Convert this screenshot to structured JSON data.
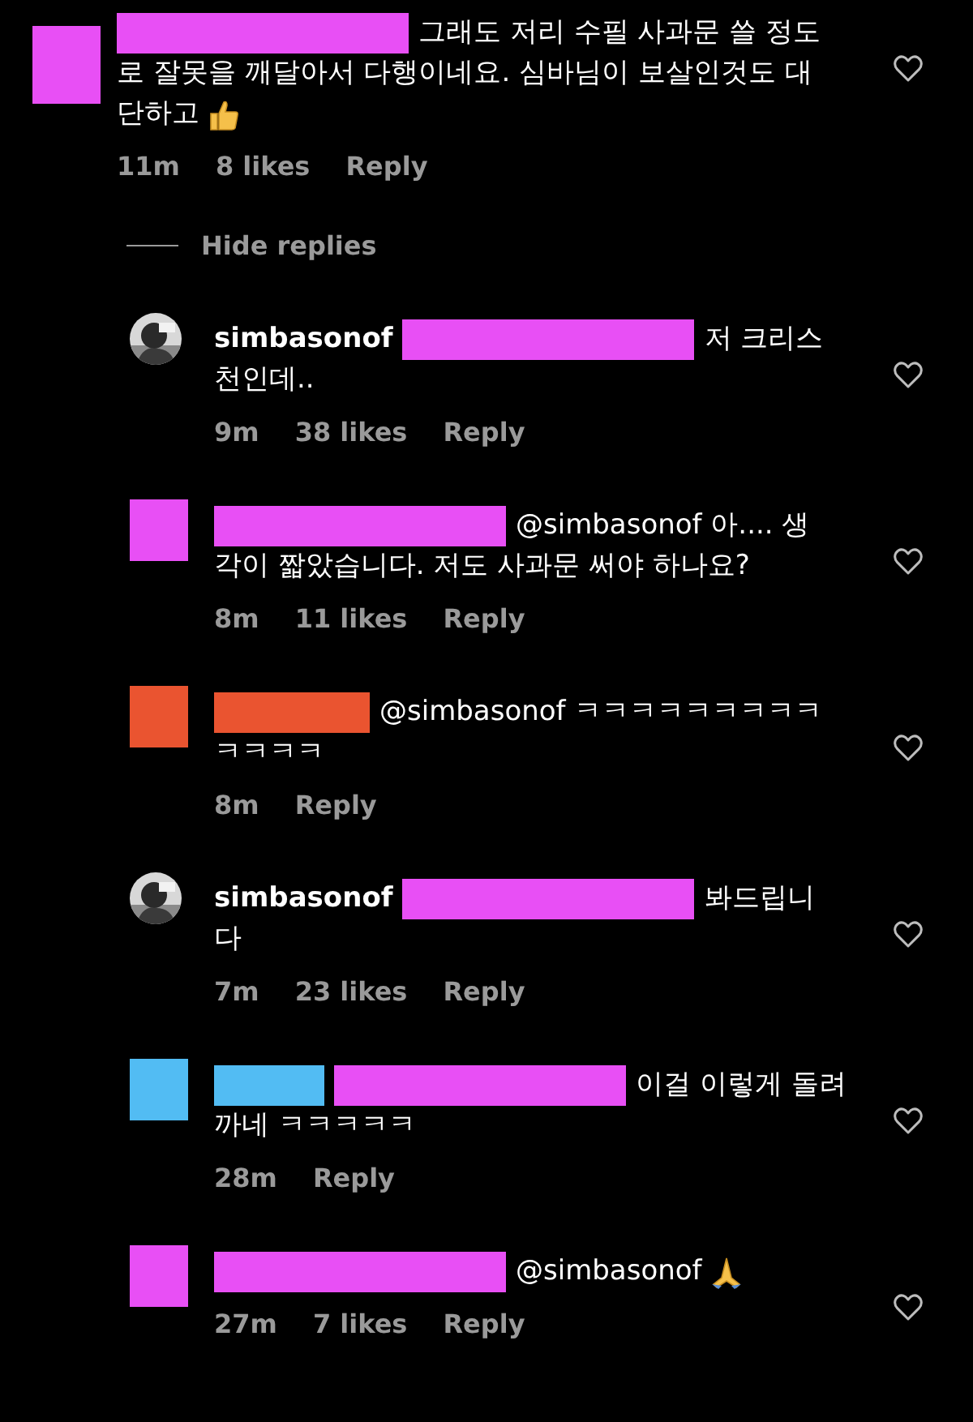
{
  "comments": [
    {
      "avatar": {
        "kind": "redacted",
        "color": "#e84ff5"
      },
      "redactions": [
        {
          "kind": "name",
          "color": "#e84ff5"
        }
      ],
      "lines": [
        "그래도 저리 수필 사과문 쓸 정도",
        "로 잘못을 깨달아서 다행이네요. 심바님이 보살인것도 대",
        "단하고"
      ],
      "end_icon": {
        "kind": "thumbs-up"
      },
      "time": "11m",
      "likes": "8 likes",
      "reply": "Reply"
    }
  ],
  "hide_replies": "Hide replies",
  "replies": [
    {
      "avatar": {
        "kind": "picture"
      },
      "username": "simbasonof",
      "redactions": [
        {
          "kind": "name",
          "color": "#e84ff5"
        }
      ],
      "lines": [
        "저 크리스",
        "천인데.."
      ],
      "time": "9m",
      "likes": "38 likes",
      "reply": "Reply"
    },
    {
      "avatar": {
        "kind": "redacted",
        "color": "#e84ff5"
      },
      "redactions": [
        {
          "kind": "name",
          "color": "#e84ff5"
        }
      ],
      "lines": [
        "@simbasonof 아.... 생",
        "각이 짧았습니다. 저도 사과문 써야 하나요?"
      ],
      "time": "8m",
      "likes": "11 likes",
      "reply": "Reply"
    },
    {
      "avatar": {
        "kind": "redacted",
        "color": "#ea5430"
      },
      "redactions": [
        {
          "kind": "medium",
          "color": "#ea5430"
        }
      ],
      "lines": [
        "@simbasonof ㅋㅋㅋㅋㅋㅋㅋㅋㅋ",
        "ㅋㅋㅋㅋ"
      ],
      "time": "8m",
      "reply": "Reply"
    },
    {
      "avatar": {
        "kind": "picture"
      },
      "username": "simbasonof",
      "redactions": [
        {
          "kind": "name",
          "color": "#e84ff5"
        }
      ],
      "lines": [
        "봐드립니",
        "다"
      ],
      "time": "7m",
      "likes": "23 likes",
      "reply": "Reply"
    },
    {
      "avatar": {
        "kind": "redacted",
        "color": "#52bcf3"
      },
      "redactions": [
        {
          "kind": "short",
          "color": "#52bcf3"
        },
        {
          "kind": "name",
          "color": "#e84ff5"
        }
      ],
      "lines": [
        "이걸 이렇게 돌려",
        "까네 ㅋㅋㅋㅋㅋ"
      ],
      "time": "28m",
      "reply": "Reply"
    },
    {
      "avatar": {
        "kind": "redacted",
        "color": "#e84ff5"
      },
      "redactions": [
        {
          "kind": "name",
          "color": "#e84ff5"
        }
      ],
      "lines": [
        "@simbasonof"
      ],
      "end_icon": {
        "kind": "folded-hands"
      },
      "time": "27m",
      "likes": "7 likes",
      "reply": "Reply"
    }
  ]
}
